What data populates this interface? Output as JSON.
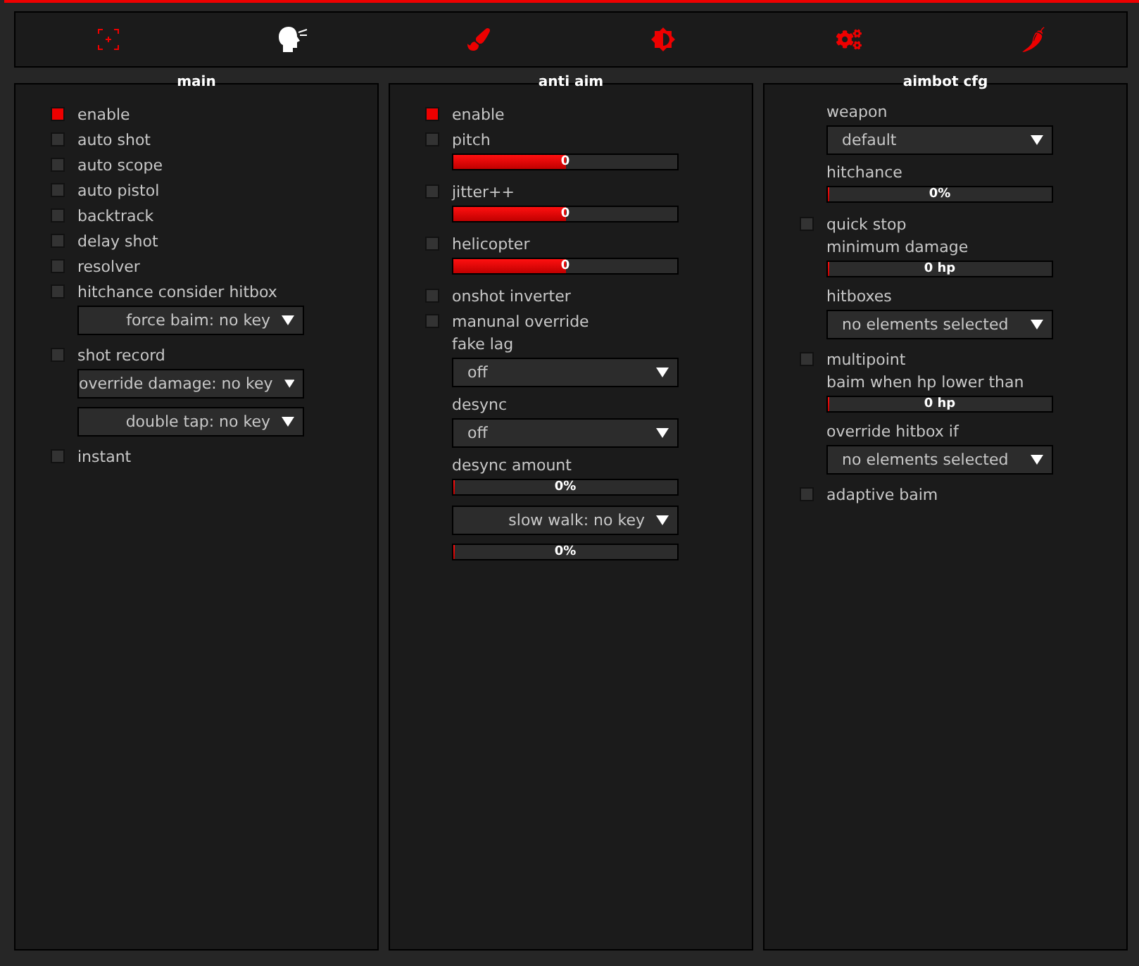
{
  "tabs": [
    {
      "selected": false
    },
    {
      "selected": true
    },
    {
      "selected": false
    },
    {
      "selected": false
    },
    {
      "selected": false
    },
    {
      "selected": false
    }
  ],
  "panels": [
    {
      "title": "main",
      "items": [
        {
          "kind": "checkbox",
          "label": "enable",
          "checked": true
        },
        {
          "kind": "checkbox",
          "label": "auto shot",
          "checked": false
        },
        {
          "kind": "checkbox",
          "label": "auto scope",
          "checked": false
        },
        {
          "kind": "checkbox",
          "label": "auto pistol",
          "checked": false
        },
        {
          "kind": "checkbox",
          "label": "backtrack",
          "checked": false
        },
        {
          "kind": "checkbox",
          "label": "delay shot",
          "checked": false
        },
        {
          "kind": "checkbox",
          "label": "resolver",
          "checked": false
        },
        {
          "kind": "checkbox",
          "label": "hitchance consider hitbox",
          "checked": false
        },
        {
          "kind": "keybind",
          "value": "force baim: no key"
        },
        {
          "kind": "checkbox",
          "label": "shot record",
          "checked": false
        },
        {
          "kind": "keybind",
          "value": "override damage: no key"
        },
        {
          "kind": "keybind",
          "value": "double tap: no key"
        },
        {
          "kind": "checkbox",
          "label": "instant",
          "checked": false
        }
      ]
    },
    {
      "title": "anti aim",
      "items": [
        {
          "kind": "checkbox",
          "label": "enable",
          "checked": true
        },
        {
          "kind": "checkbox",
          "label": "pitch",
          "checked": false
        },
        {
          "kind": "slider",
          "level": 0.5,
          "reading": "0"
        },
        {
          "kind": "checkbox",
          "label": "jitter++",
          "checked": false
        },
        {
          "kind": "slider",
          "level": 0.5,
          "reading": "0"
        },
        {
          "kind": "checkbox",
          "label": "helicopter",
          "checked": false
        },
        {
          "kind": "slider",
          "level": 0.5,
          "reading": "0"
        },
        {
          "kind": "checkbox",
          "label": "onshot inverter",
          "checked": false
        },
        {
          "kind": "checkbox",
          "label": "manunal override",
          "checked": false
        },
        {
          "kind": "label",
          "text": "fake lag"
        },
        {
          "kind": "dropdown",
          "value": "off"
        },
        {
          "kind": "label",
          "text": "desync"
        },
        {
          "kind": "dropdown",
          "value": "off"
        },
        {
          "kind": "label",
          "text": "desync amount"
        },
        {
          "kind": "slider",
          "level": 0,
          "reading": "0%"
        },
        {
          "kind": "keybind",
          "value": "slow walk: no key"
        },
        {
          "kind": "slider",
          "level": 0,
          "reading": "0%"
        }
      ]
    },
    {
      "title": "aimbot cfg",
      "items": [
        {
          "kind": "label",
          "text": "weapon"
        },
        {
          "kind": "dropdown",
          "value": "default"
        },
        {
          "kind": "label",
          "text": "hitchance"
        },
        {
          "kind": "slider",
          "level": 0,
          "reading": "0%"
        },
        {
          "kind": "checkbox",
          "label": "quick stop",
          "checked": false
        },
        {
          "kind": "label",
          "text": "minimum damage"
        },
        {
          "kind": "slider",
          "level": 0,
          "reading": "0 hp"
        },
        {
          "kind": "label",
          "text": "hitboxes"
        },
        {
          "kind": "dropdown",
          "value": "no elements selected"
        },
        {
          "kind": "checkbox",
          "label": "multipoint",
          "checked": false
        },
        {
          "kind": "label",
          "text": "baim when hp lower than"
        },
        {
          "kind": "slider",
          "level": 0,
          "reading": "0 hp"
        },
        {
          "kind": "label",
          "text": "override hitbox if"
        },
        {
          "kind": "dropdown",
          "value": "no elements selected"
        },
        {
          "kind": "checkbox",
          "label": "adaptive baim",
          "checked": false
        }
      ]
    }
  ]
}
